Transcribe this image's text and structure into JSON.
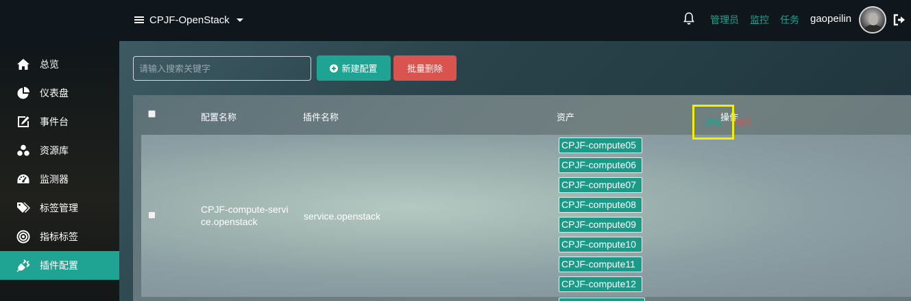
{
  "header": {
    "project_name": "CPJF-OpenStack",
    "links": [
      "管理员",
      "监控",
      "任务"
    ],
    "username": "gaopeilin"
  },
  "sidebar": {
    "items": [
      {
        "label": "总览",
        "icon": "home-icon"
      },
      {
        "label": "仪表盘",
        "icon": "pie-chart-icon"
      },
      {
        "label": "事件台",
        "icon": "edit-icon"
      },
      {
        "label": "资源库",
        "icon": "cubes-icon"
      },
      {
        "label": "监测器",
        "icon": "dashboard-icon"
      },
      {
        "label": "标签管理",
        "icon": "tags-icon"
      },
      {
        "label": "指标标签",
        "icon": "target-icon"
      },
      {
        "label": "插件配置",
        "icon": "plug-icon",
        "active": true
      }
    ]
  },
  "toolbar": {
    "search_placeholder": "请输入搜索关键字",
    "new_label": "新建配置",
    "batch_delete_label": "批量删除"
  },
  "table": {
    "headers": [
      "配置名称",
      "插件名称",
      "资产",
      "操作"
    ],
    "rows": [
      {
        "config_name_line1": "CPJF-compute-servi",
        "config_name_line2": "ce.openstack",
        "plugin_name": "service.openstack",
        "assets": [
          "CPJF-compute05",
          "CPJF-compute06",
          "CPJF-compute07",
          "CPJF-compute08",
          "CPJF-compute09",
          "CPJF-compute10",
          "CPJF-compute11",
          "CPJF-compute12"
        ],
        "actions": {
          "edit": "编辑",
          "delete": "删除"
        }
      }
    ]
  },
  "colors": {
    "accent": "#1fa392",
    "danger": "#d9534f",
    "highlight": "#f5f000"
  }
}
